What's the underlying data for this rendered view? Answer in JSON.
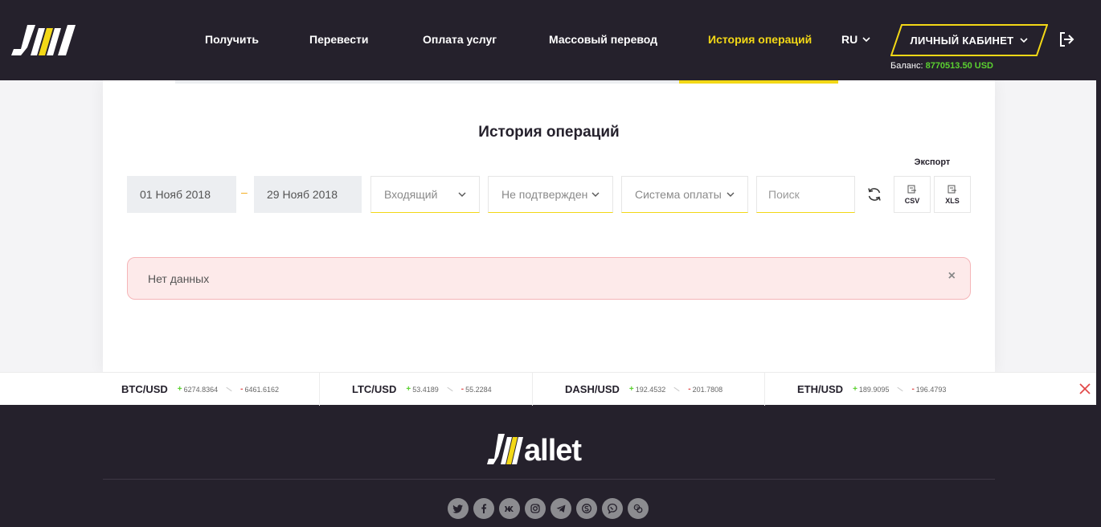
{
  "header": {
    "nav": [
      {
        "label": "Получить",
        "active": false
      },
      {
        "label": "Перевести",
        "active": false
      },
      {
        "label": "Оплата услуг",
        "active": false
      },
      {
        "label": "Массовый перевод",
        "active": false
      },
      {
        "label": "История операций",
        "active": true
      }
    ],
    "language": "RU",
    "cabinet_label": "ЛИЧНЫЙ КАБИНЕТ",
    "balance_label": "Баланс:",
    "balance_amount": "8770513.50 USD"
  },
  "main": {
    "title": "История операций",
    "date_from": "01 Нояб 2018",
    "date_separator": "–",
    "date_to": "29 Нояб 2018",
    "filters": {
      "direction": "Входящий",
      "status": "Не подтвержден",
      "payment_system": "Система оплаты"
    },
    "search_placeholder": "Поиск",
    "export": {
      "title": "Экспорт",
      "csv": "CSV",
      "xls": "XLS"
    },
    "alert_text": "Нет данных",
    "alert_close": "×"
  },
  "ticker": [
    {
      "pair": "BTC/USD",
      "buy": "6274.8364",
      "sell": "6461.6162"
    },
    {
      "pair": "LTC/USD",
      "buy": "53.4189",
      "sell": "55.2284"
    },
    {
      "pair": "DASH/USD",
      "buy": "192.4532",
      "sell": "201.7808"
    },
    {
      "pair": "ETH/USD",
      "buy": "189.9095",
      "sell": "196.4793"
    }
  ],
  "footer": {
    "logo_word": "allet",
    "socials": [
      "twitter-icon",
      "facebook-icon",
      "vk-icon",
      "instagram-icon",
      "telegram-icon",
      "skype-icon",
      "viber-icon",
      "wechat-icon"
    ]
  },
  "colors": {
    "brand_dark": "#25212c",
    "accent_yellow": "#f3d816",
    "balance_green": "#5bd130",
    "alert_bg": "#fdeaea"
  }
}
